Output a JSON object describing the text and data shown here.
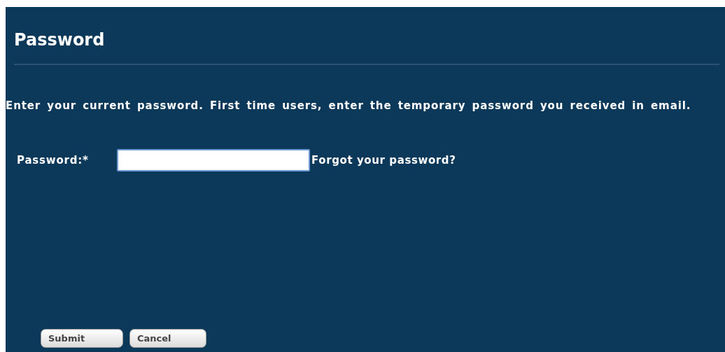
{
  "title": "Password",
  "instructions": "Enter your current password. First time users, enter the temporary password you received in email.",
  "field": {
    "label": "Password:*"
  },
  "forgot_link": "Forgot your password?",
  "buttons": [
    {
      "label": "Submit"
    },
    {
      "label": "Cancel"
    }
  ]
}
